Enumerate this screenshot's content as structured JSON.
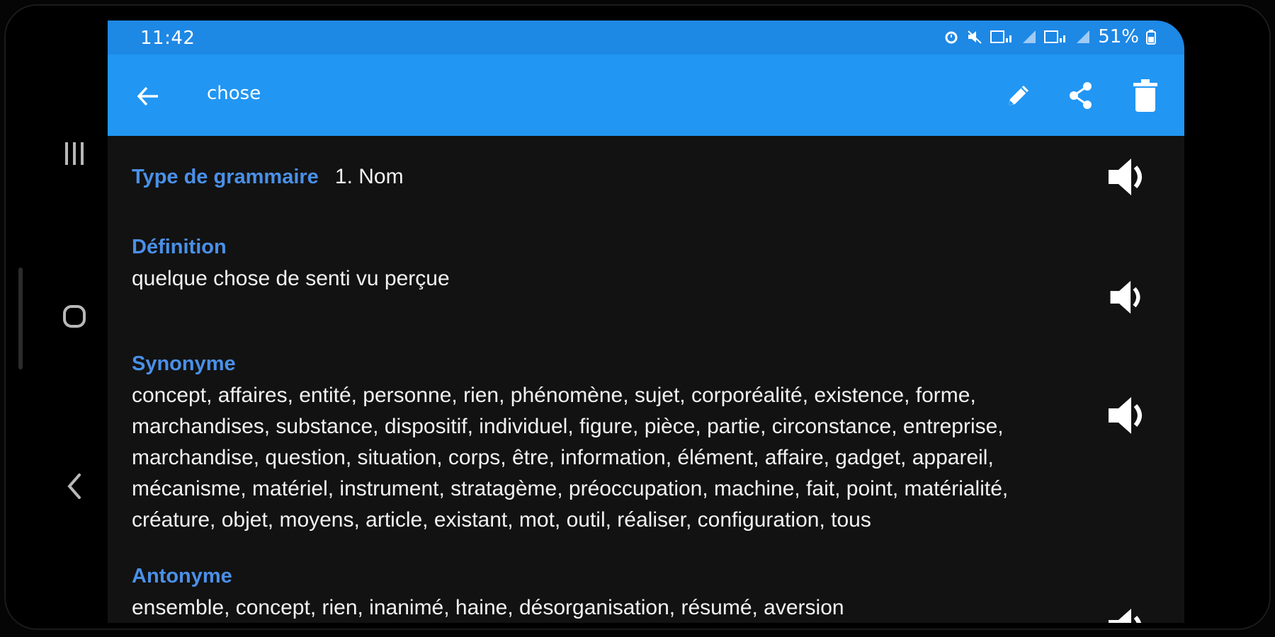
{
  "status_bar": {
    "time": "11:42",
    "battery": "51%",
    "icons": [
      "alarm-icon",
      "mute-icon",
      "volte-icon",
      "signal-icon",
      "volte-icon",
      "signal-icon",
      "battery-icon"
    ]
  },
  "app_bar": {
    "title": "chose",
    "back_icon": "arrow-left-icon",
    "actions": [
      "edit-icon",
      "share-icon",
      "delete-icon"
    ]
  },
  "entry": {
    "grammar_label": "Type de grammaire",
    "grammar_value": "1. Nom",
    "definition_label": "Définition",
    "definition_value": "quelque chose de senti vu perçue",
    "synonym_label": "Synonyme",
    "synonym_value": "concept, affaires, entité, personne, rien, phénomène, sujet, corporéalité, existence, forme, marchandises, substance, dispositif, individuel, figure, pièce, partie, circonstance, entreprise, marchandise, question, situation, corps, être, information, élément, affaire, gadget, appareil, mécanisme, matériel, instrument, stratagème, préoccupation, machine, fait, point, matérialité, créature, objet, moyens, article, existant, mot, outil, réaliser, configuration, tous",
    "antonym_label": "Antonyme",
    "antonym_value": "ensemble, concept, rien, inanimé, haine, désorganisation, résumé, aversion"
  },
  "colors": {
    "status_bar": "#1e88e5",
    "app_bar": "#2196f3",
    "background": "#121212",
    "label": "#4a90e8",
    "text": "#f2f2f2"
  },
  "nav_bar": {
    "icons": [
      "recent-apps-icon",
      "home-icon",
      "back-icon"
    ]
  }
}
